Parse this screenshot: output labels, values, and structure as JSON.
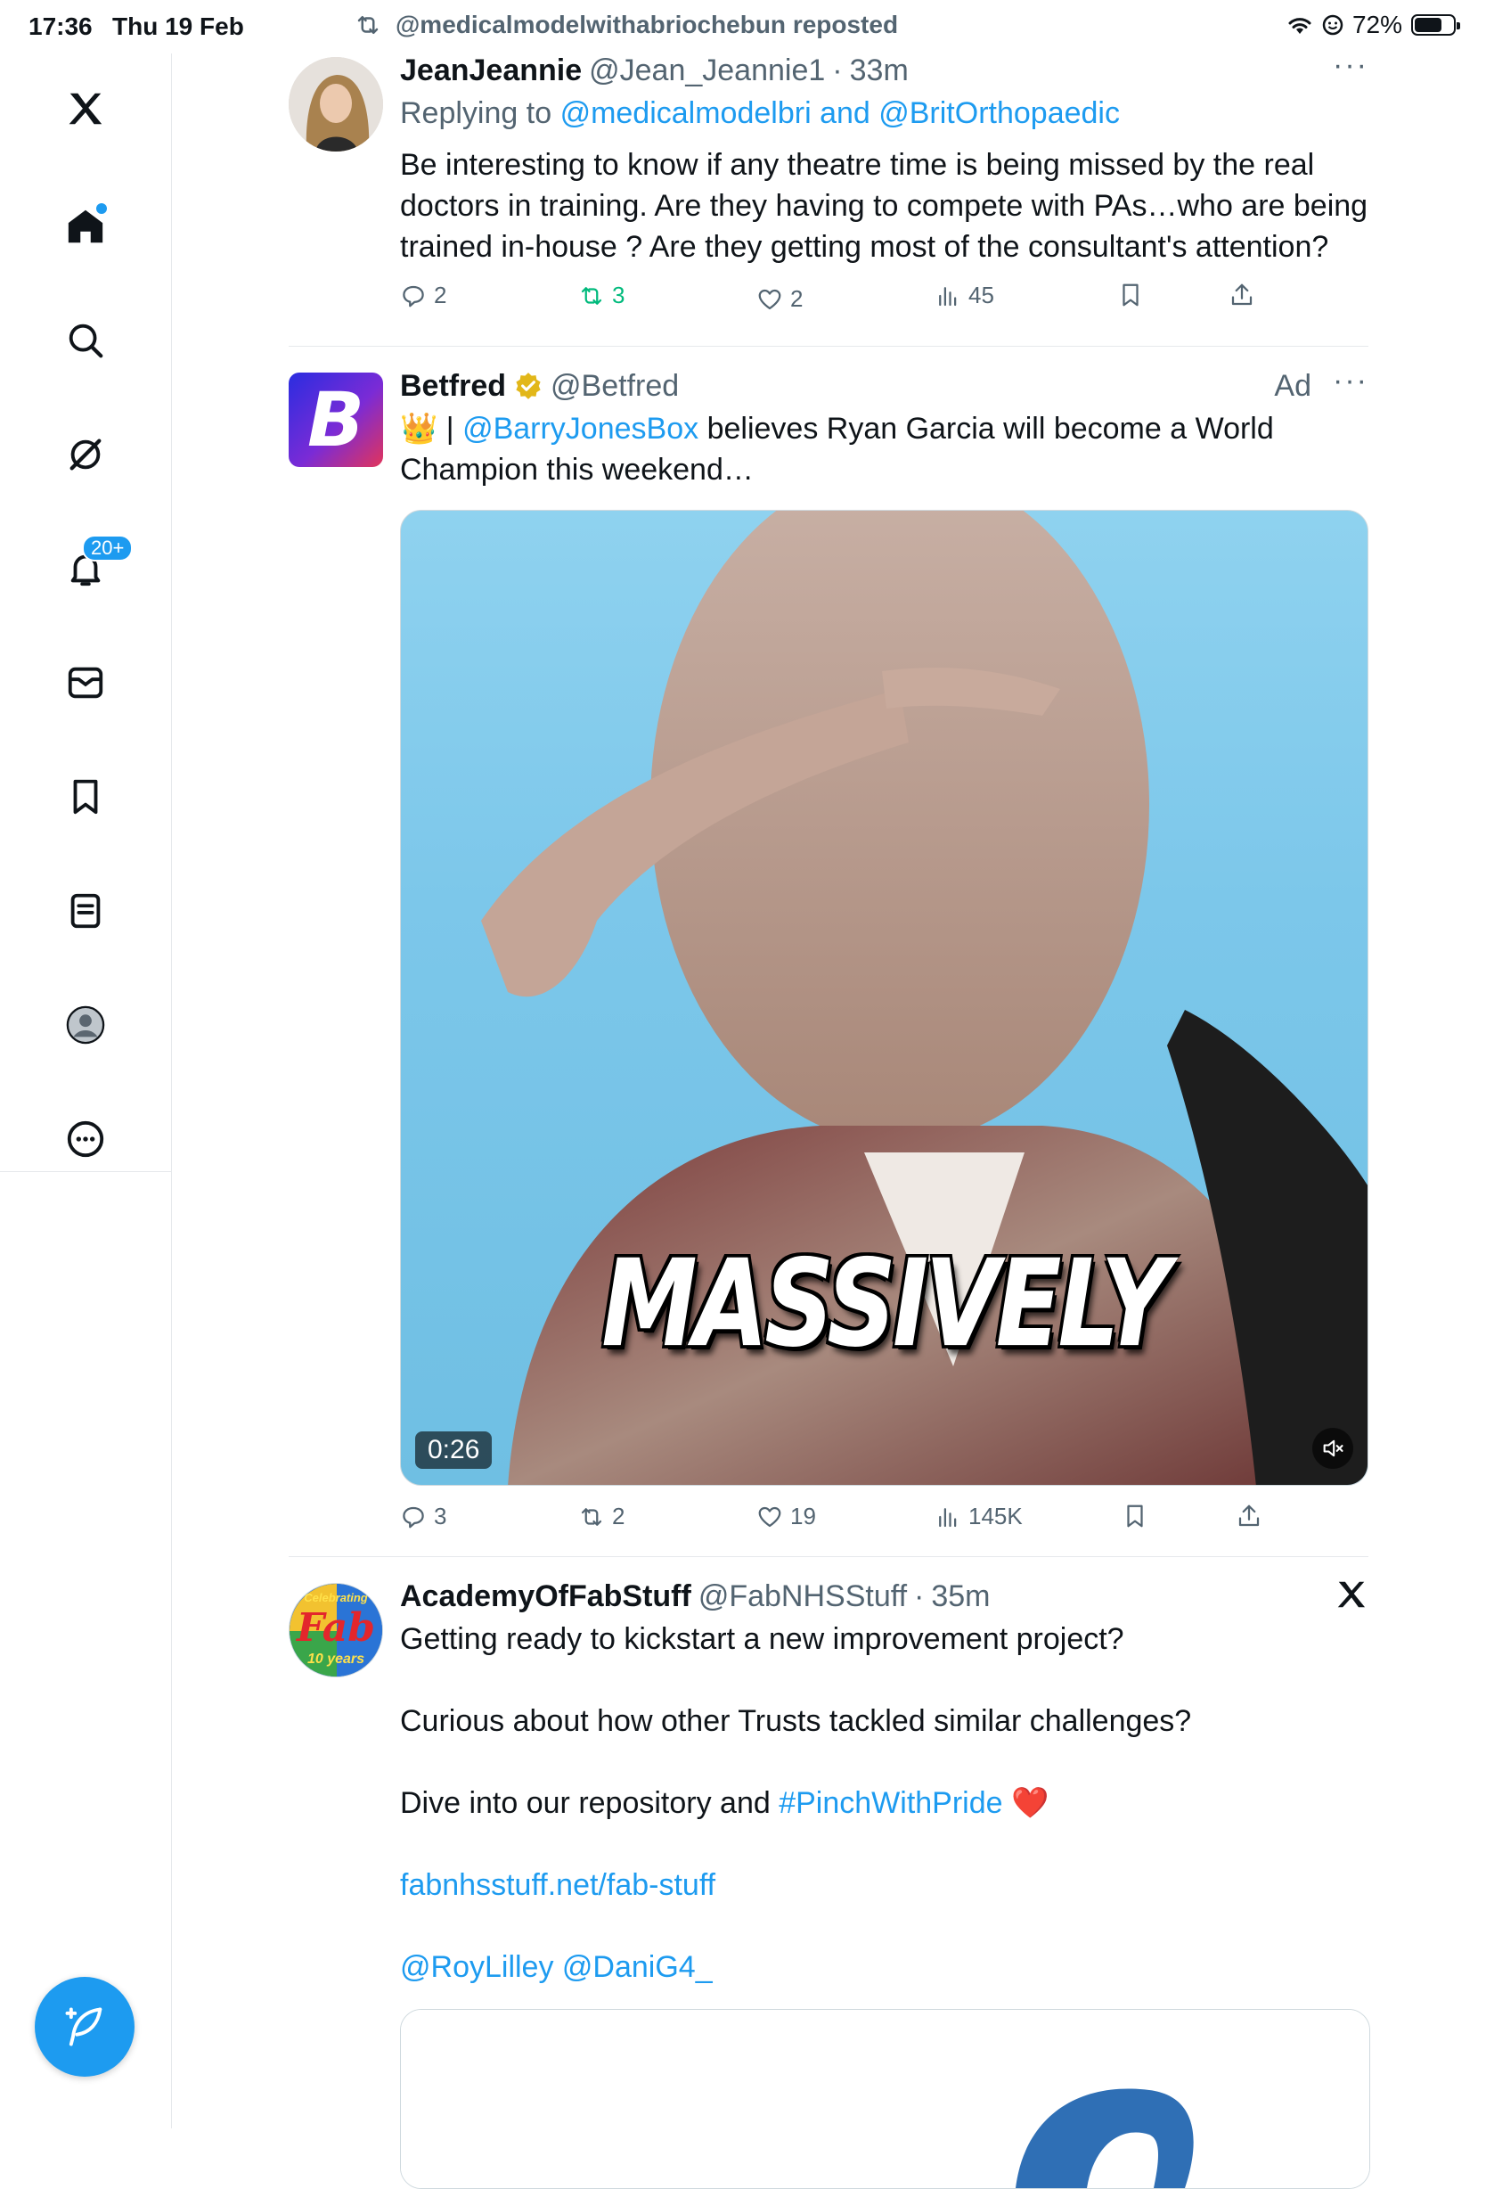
{
  "status_bar": {
    "time": "17:36",
    "date": "Thu 19 Feb",
    "battery_label": "72%",
    "battery_level": 0.72
  },
  "sidebar": {
    "notifications_badge": "20+",
    "accent_color": "#1d9bf0"
  },
  "feed": {
    "repost_label": "@medicalmodelwithabriochebun reposted",
    "tweets": [
      {
        "name": "JeanJeannie",
        "handle": "@Jean_Jeannie1",
        "sep": "·",
        "time": "33m",
        "replying_prefix": "Replying to",
        "replying_to": "@medicalmodelbri and @BritOrthopaedic",
        "text": "Be interesting to know if any theatre time is being missed by the real doctors in training. Are they having to compete with PAs…who are being trained in-house ? Are they getting most of the consultant's attention?",
        "replies": "2",
        "reposts": "3",
        "likes": "2",
        "views": "45",
        "more": "···"
      },
      {
        "name": "Betfred",
        "handle": "@Betfred",
        "ad_label": "Ad",
        "text_prefix": "👑 | ",
        "mention": "@BarryJonesBox",
        "text_rest": " believes Ryan Garcia will become a World Champion this weekend…",
        "video_caption": "MASSIVELY",
        "video_time": "0:26",
        "replies": "3",
        "reposts": "2",
        "likes": "19",
        "views": "145K",
        "more": "···"
      },
      {
        "name": "AcademyOfFabStuff",
        "handle": "@FabNHSStuff",
        "sep": "·",
        "time": "35m",
        "para1": "Getting ready to kickstart a new improvement project?",
        "para2": "Curious about how other Trusts tackled similar challenges?",
        "para3_prefix": "Dive into our repository and ",
        "hashtag": "#PinchWithPride",
        "heart": "❤️",
        "link": "fabnhsstuff.net/fab-stuff",
        "mentions": "@RoyLilley @DaniG4_",
        "avatar_text_top": "Celebrating",
        "avatar_text_mid": "Fab",
        "avatar_text_bottom": "10 years"
      }
    ]
  }
}
